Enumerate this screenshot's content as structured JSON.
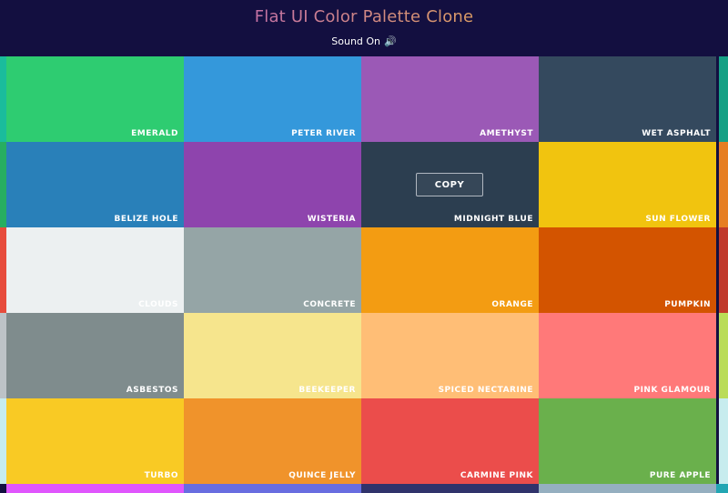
{
  "header": {
    "title": "Flat UI Color Palette Clone",
    "sound_label": "Sound On",
    "sound_icon": "speaker-icon"
  },
  "copy_button": {
    "label": "COPY",
    "hover_on": "MIDNIGHT BLUE"
  },
  "swatches": [
    {
      "name": "EMERALD",
      "color": "#2ecc71"
    },
    {
      "name": "PETER RIVER",
      "color": "#3498db"
    },
    {
      "name": "AMETHYST",
      "color": "#9b59b6"
    },
    {
      "name": "WET ASPHALT",
      "color": "#34495e"
    },
    {
      "name": "BELIZE HOLE",
      "color": "#2980b9"
    },
    {
      "name": "WISTERIA",
      "color": "#8e44ad"
    },
    {
      "name": "MIDNIGHT BLUE",
      "color": "#2c3e50"
    },
    {
      "name": "SUN FLOWER",
      "color": "#f1c40f"
    },
    {
      "name": "CLOUDS",
      "color": "#ecf0f1"
    },
    {
      "name": "CONCRETE",
      "color": "#95a5a6"
    },
    {
      "name": "ORANGE",
      "color": "#f39c12"
    },
    {
      "name": "PUMPKIN",
      "color": "#d35400"
    },
    {
      "name": "ASBESTOS",
      "color": "#7f8c8d"
    },
    {
      "name": "BEEKEEPER",
      "color": "#f6e58d"
    },
    {
      "name": "SPICED NECTARINE",
      "color": "#ffbe76"
    },
    {
      "name": "PINK GLAMOUR",
      "color": "#ff7979"
    },
    {
      "name": "TURBO",
      "color": "#f9ca24"
    },
    {
      "name": "QUINCE JELLY",
      "color": "#f0932b"
    },
    {
      "name": "CARMINE PINK",
      "color": "#eb4d4b"
    },
    {
      "name": "PURE APPLE",
      "color": "#6ab04c"
    }
  ],
  "side_colors": {
    "left": [
      "#1abc9c",
      "#27ae60",
      "#e74c3c",
      "#bdc3c7",
      "#c7ecee"
    ],
    "right": [
      "#16a085",
      "#e67e22",
      "#c0392b",
      "#badc58",
      "#c7ecee"
    ]
  },
  "bottom_row_colors": [
    "#e056fd",
    "#686de0",
    "#30336b",
    "#95afc0",
    "#22a6b3"
  ]
}
